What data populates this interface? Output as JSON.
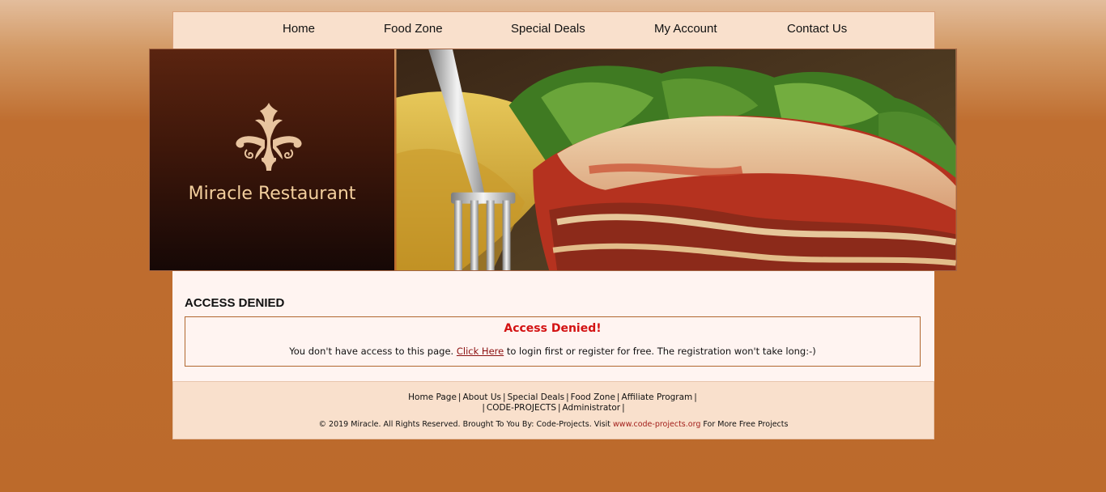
{
  "nav": {
    "items": [
      "Home",
      "Food Zone",
      "Special Deals",
      "My Account",
      "Contact Us"
    ]
  },
  "banner": {
    "brand_name": "Miracle Restaurant"
  },
  "content": {
    "heading": "ACCESS DENIED",
    "box_title": "Access Denied!",
    "msg_before": "You don't have access to this page. ",
    "msg_link": "Click Here",
    "msg_after": " to login first or register for free. The registration won't take long:-)"
  },
  "footer": {
    "links_row1": [
      "Home Page",
      "About Us",
      "Special Deals",
      "Food Zone",
      "Affiliate Program"
    ],
    "links_row2": [
      "CODE-PROJECTS",
      "Administrator"
    ],
    "copy_before": "© 2019 Miracle. All Rights Reserved. Brought To You By: Code-Projects. Visit ",
    "copy_url": "www.code-projects.org",
    "copy_after": " For More Free Projects"
  },
  "colors": {
    "nav_bg": "#f9e0cc",
    "brand_title": "#f3cf9d",
    "denied_red": "#d31212",
    "link_red": "#8b1010"
  }
}
